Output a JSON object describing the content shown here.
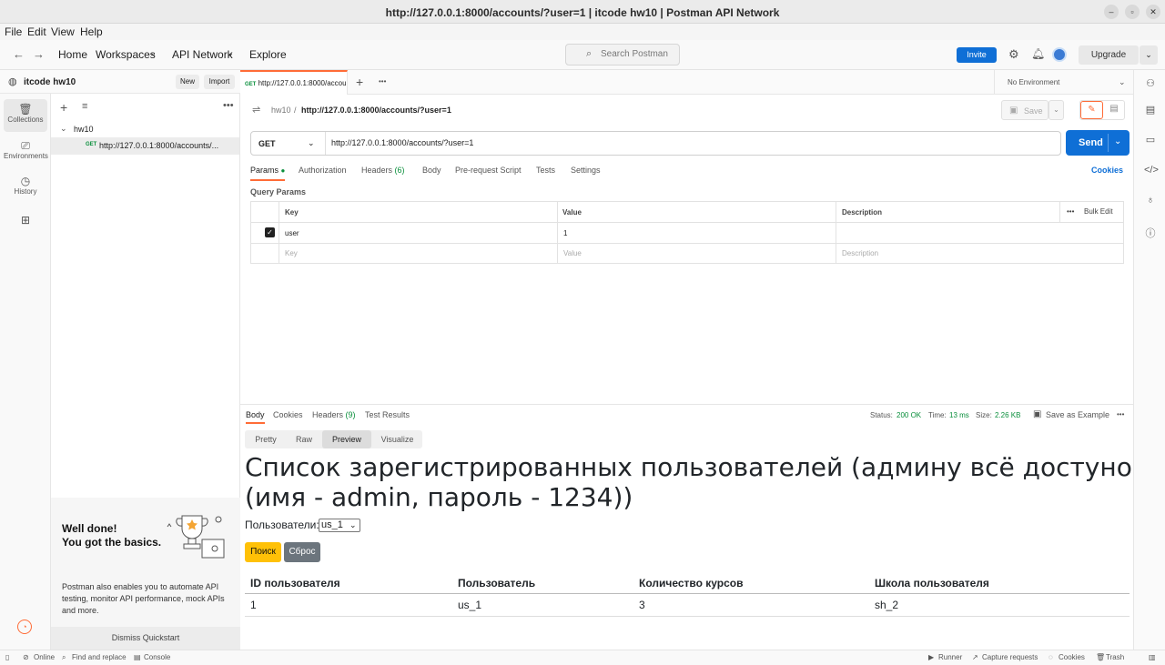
{
  "window": {
    "title": "http://127.0.0.1:8000/accounts/?user=1 | itcode hw10 | Postman API Network"
  },
  "menu": [
    "File",
    "Edit",
    "View",
    "Help"
  ],
  "nav": {
    "home": "Home",
    "workspaces": "Workspaces",
    "api_network": "API Network",
    "explore": "Explore",
    "search_placeholder": "Search Postman",
    "invite": "Invite",
    "upgrade": "Upgrade"
  },
  "rail": {
    "collections": "Collections",
    "environments": "Environments",
    "history": "History"
  },
  "workspace": {
    "name": "itcode hw10",
    "new": "New",
    "import": "Import"
  },
  "tree": {
    "collection": "hw10",
    "request_method": "GET",
    "request_name": "http://127.0.0.1:8000/accounts/..."
  },
  "quickstart": {
    "title1": "Well done!",
    "title2": "You got the basics.",
    "body": "Postman also enables you to automate API testing, monitor API performance, mock APIs and more.",
    "dismiss": "Dismiss Quickstart"
  },
  "tab": {
    "method": "GET",
    "label": "http://127.0.0.1:8000/accou"
  },
  "environment": "No Environment",
  "request": {
    "breadcrumb_collection": "hw10",
    "breadcrumb_sep": "/",
    "breadcrumb_name": "http://127.0.0.1:8000/accounts/?user=1",
    "save": "Save",
    "method": "GET",
    "url": "http://127.0.0.1:8000/accounts/?user=1",
    "send": "Send"
  },
  "req_tabs": {
    "params": "Params",
    "authorization": "Authorization",
    "headers": "Headers",
    "headers_count": "(6)",
    "body": "Body",
    "prerequest": "Pre-request Script",
    "tests": "Tests",
    "settings": "Settings",
    "cookies": "Cookies"
  },
  "params": {
    "title": "Query Params",
    "columns": {
      "key": "Key",
      "value": "Value",
      "description": "Description",
      "bulk": "Bulk Edit"
    },
    "row": {
      "key": "user",
      "value": "1"
    },
    "placeholder": {
      "key": "Key",
      "value": "Value",
      "description": "Description"
    }
  },
  "response": {
    "tabs": {
      "body": "Body",
      "cookies": "Cookies",
      "headers": "Headers",
      "headers_count": "(9)",
      "tests": "Test Results"
    },
    "status_label": "Status:",
    "status": "200 OK",
    "time_label": "Time:",
    "time": "13 ms",
    "size_label": "Size:",
    "size": "2.26 KB",
    "save_example": "Save as Example",
    "view": {
      "pretty": "Pretty",
      "raw": "Raw",
      "preview": "Preview",
      "visualize": "Visualize"
    }
  },
  "preview": {
    "heading": "Список зарегистрированных пользователей (админу всё достуно (имя - admin, пароль - 1234))",
    "users_label": "Пользователи:",
    "user_selected": "us_1",
    "find": "Поиск",
    "reset": "Сброс",
    "columns": [
      "ID пользователя",
      "Пользователь",
      "Количество курсов",
      "Школа пользователя"
    ],
    "rows": [
      [
        "1",
        "us_1",
        "3",
        "sh_2"
      ]
    ]
  },
  "statusbar": {
    "online": "Online",
    "find_replace": "Find and replace",
    "console": "Console",
    "runner": "Runner",
    "capture": "Capture requests",
    "cookies": "Cookies",
    "trash": "Trash"
  },
  "colors": {
    "accent": "#ff6c37",
    "primary": "#0f6fd6",
    "success": "#0a8f3c",
    "warning": "#ffc107"
  }
}
